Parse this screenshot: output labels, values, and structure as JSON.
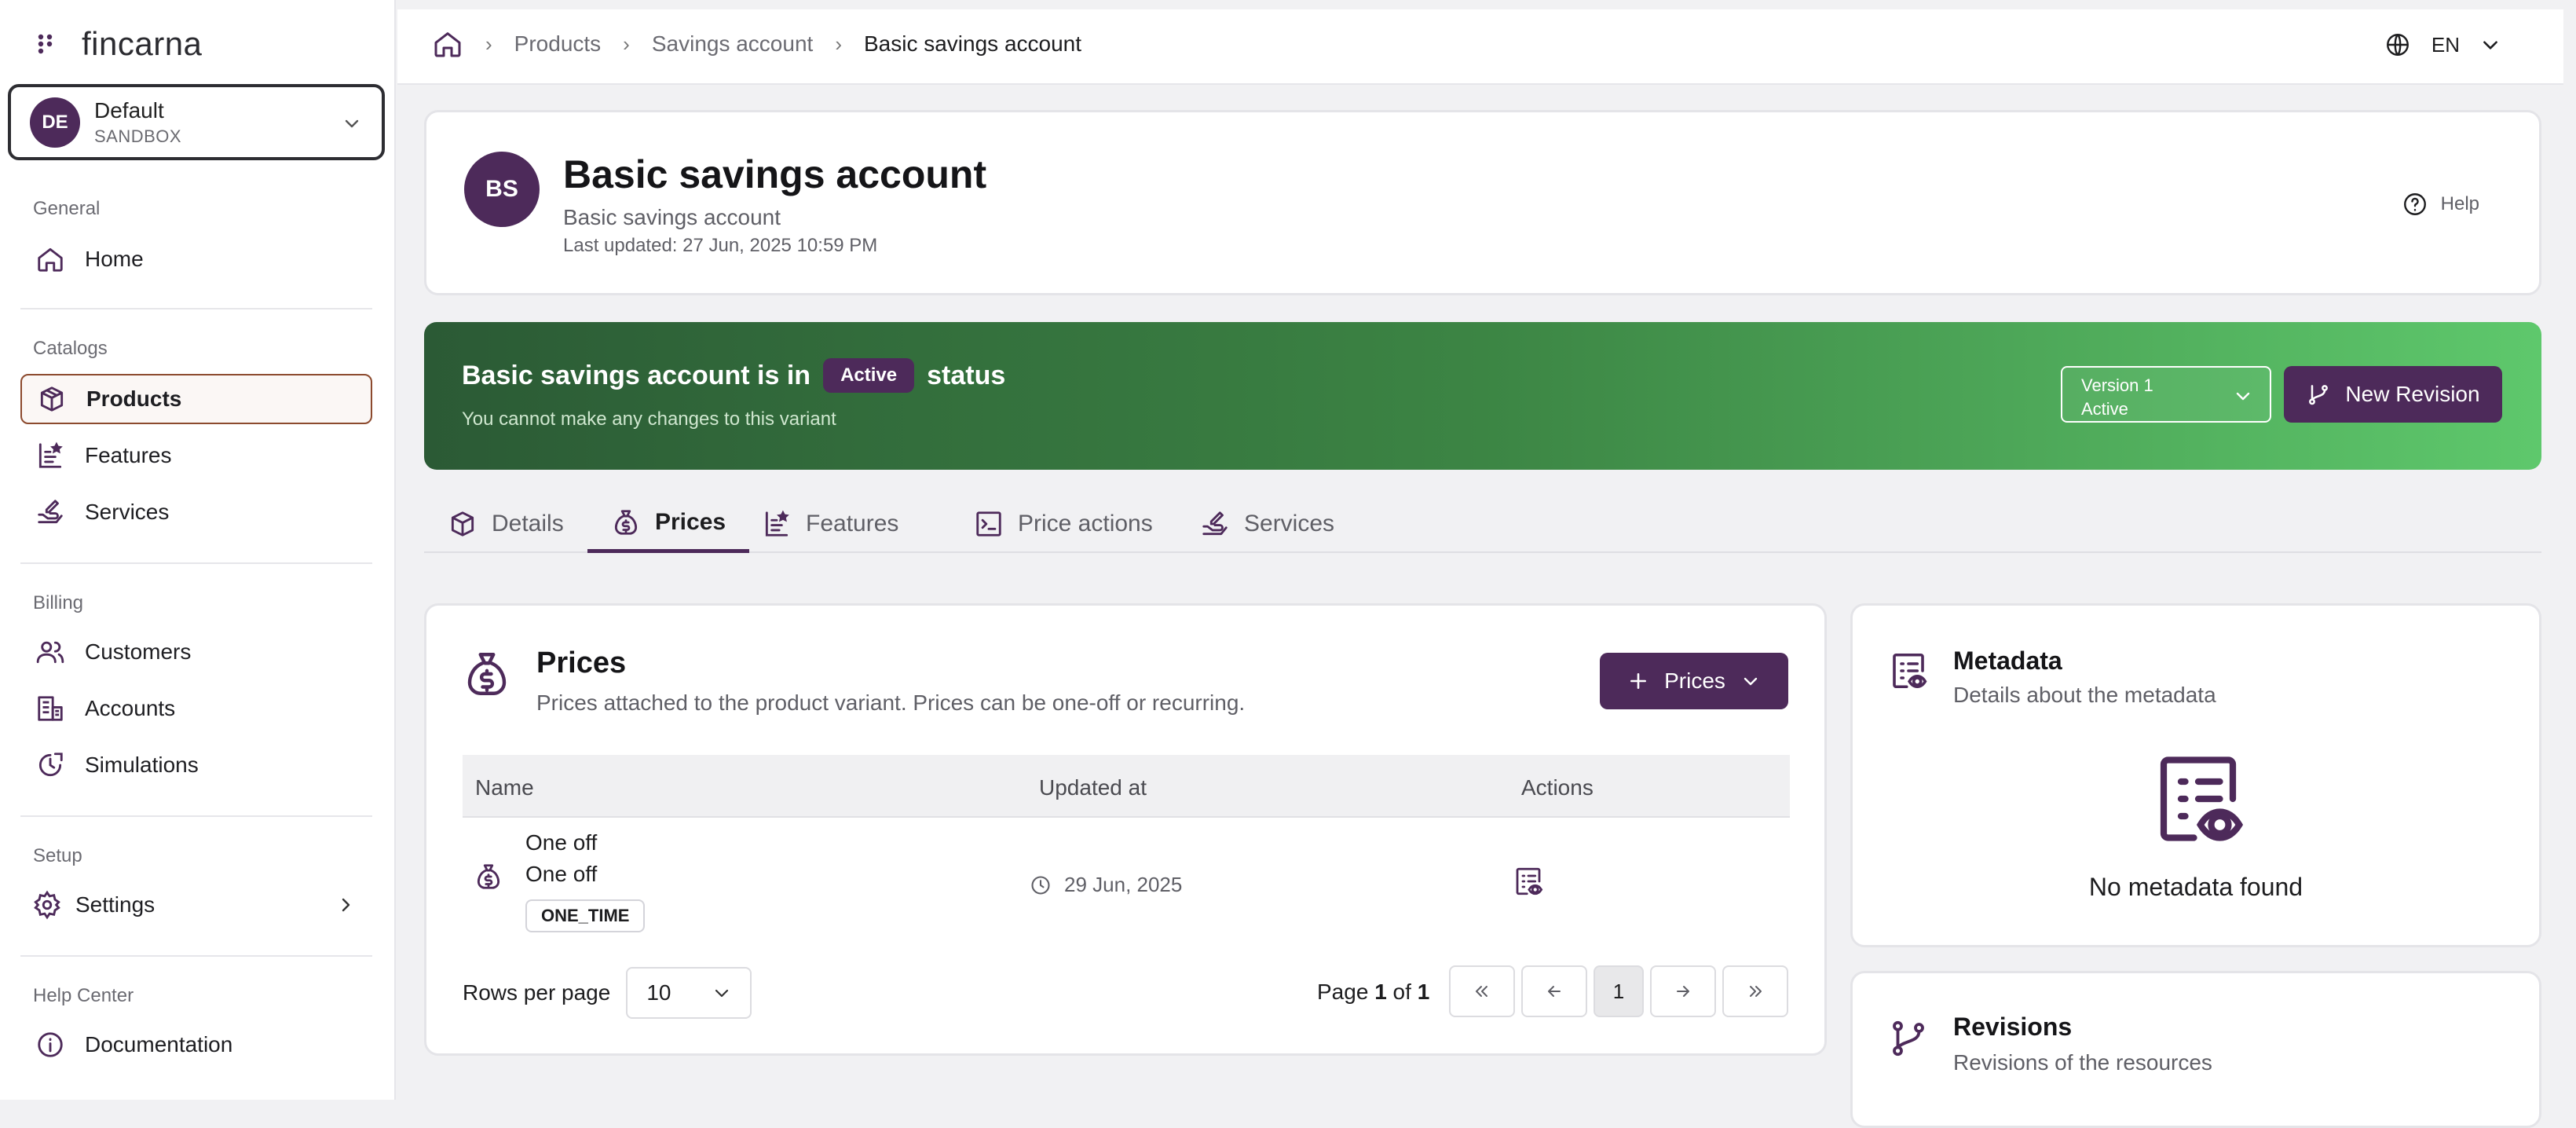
{
  "brand": {
    "name": "fincarna"
  },
  "environment": {
    "initials": "DE",
    "name": "Default",
    "type": "SANDBOX"
  },
  "sidebar": {
    "sections": [
      {
        "title": "General",
        "items": [
          {
            "label": "Home",
            "icon": "home-icon"
          }
        ]
      },
      {
        "title": "Catalogs",
        "items": [
          {
            "label": "Products",
            "icon": "box-icon",
            "active": true
          },
          {
            "label": "Features",
            "icon": "feature-icon"
          },
          {
            "label": "Services",
            "icon": "service-icon"
          }
        ]
      },
      {
        "title": "Billing",
        "items": [
          {
            "label": "Customers",
            "icon": "users-icon"
          },
          {
            "label": "Accounts",
            "icon": "accounts-icon"
          },
          {
            "label": "Simulations",
            "icon": "simulation-icon"
          }
        ]
      },
      {
        "title": "Setup",
        "items": [
          {
            "label": "Settings",
            "icon": "gear-icon"
          }
        ]
      },
      {
        "title": "Help Center",
        "items": [
          {
            "label": "Documentation",
            "icon": "info-icon"
          }
        ]
      }
    ]
  },
  "breadcrumb": {
    "items": [
      "Products",
      "Savings account",
      "Basic savings account"
    ]
  },
  "language": {
    "code": "EN"
  },
  "header": {
    "initials": "BS",
    "title": "Basic savings account",
    "subtitle": "Basic savings account",
    "updated": "Last updated: 27 Jun, 2025 10:59 PM",
    "help": "Help"
  },
  "status_banner": {
    "prefix": "Basic savings account is in",
    "status": "Active",
    "suffix": "status",
    "note": "You cannot make any changes to this variant",
    "version_line1": "Version 1",
    "version_line2": "Active",
    "new_revision": "New Revision"
  },
  "tabs": [
    "Details",
    "Prices",
    "Features",
    "Price actions",
    "Services"
  ],
  "active_tab": "Prices",
  "prices": {
    "title": "Prices",
    "subtitle": "Prices attached to the product variant. Prices can be one-off or recurring.",
    "add_button": "Prices",
    "columns": [
      "Name",
      "Updated at",
      "Actions"
    ],
    "rows": [
      {
        "name": "One off",
        "description": "One off",
        "type": "ONE_TIME",
        "updated": "29 Jun, 2025"
      }
    ],
    "rows_per_page_label": "Rows per page",
    "rows_per_page": "10",
    "page_prefix": "Page",
    "page_current": "1",
    "page_of": "of",
    "page_total": "1",
    "page_button": "1"
  },
  "metadata": {
    "title": "Metadata",
    "subtitle": "Details about the metadata",
    "empty": "No metadata found"
  },
  "revisions": {
    "title": "Revisions",
    "subtitle": "Revisions of the resources"
  },
  "colors": {
    "brand": "#4d2a5a",
    "active_nav_border": "#8c4a2e",
    "banner_start": "#2b5a35",
    "banner_end": "#5ec86c"
  }
}
